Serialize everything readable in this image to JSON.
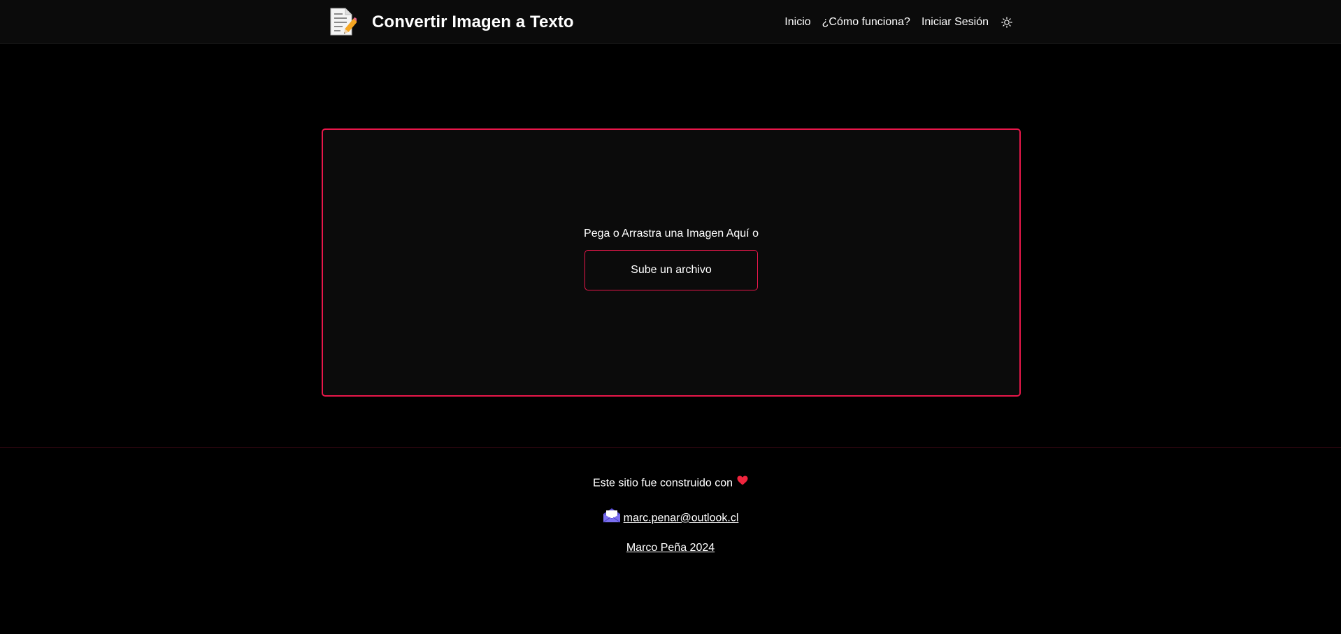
{
  "header": {
    "logo_icon": "document-pencil-icon",
    "title": "Convertir Imagen a Texto",
    "nav": [
      {
        "label": "Inicio"
      },
      {
        "label": "¿Cómo funciona?"
      },
      {
        "label": "Iniciar Sesión"
      }
    ],
    "theme_toggle_icon": "sun-icon"
  },
  "dropzone": {
    "prompt": "Pega o Arrastra una Imagen Aquí o",
    "upload_label": "Sube un archivo"
  },
  "footer": {
    "built_with": "Este sitio fue construido con",
    "heart_icon": "heart-icon",
    "mail_icon": "envelope-icon",
    "email": "marc.penar@outlook.cl",
    "credit": "Marco Peña 2024"
  },
  "colors": {
    "accent": "#e8174a",
    "background": "#000000",
    "surface": "#0b0b0b",
    "text": "#ffffff"
  }
}
